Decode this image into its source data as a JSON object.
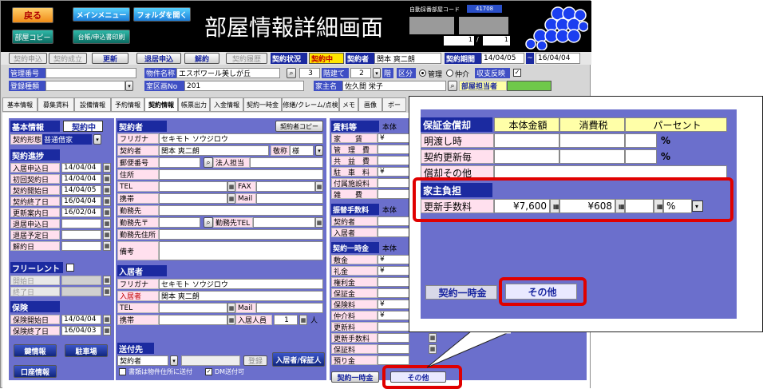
{
  "header": {
    "title": "部屋情報詳細画面",
    "back": "戻る",
    "main_menu": "メインメニュー",
    "open_folder": "フォルダを開く",
    "room_copy": "部屋コピー",
    "ledger_print": "台帳/申込書印刷",
    "auto_code_label": "自動採番部屋コード",
    "auto_code_value": "41708",
    "record_current": "1",
    "record_total": "1"
  },
  "toolbar": {
    "contract_apply": "契約申込",
    "contract_done": "契約成立",
    "update": "更新",
    "move_out_apply": "退居申込",
    "cancel": "解約",
    "contract_history": "契約履歴",
    "status_label": "契約状況",
    "status_value": "契約中",
    "contractor_label": "契約者",
    "contractor_value": "関本 爽二朗",
    "period_label": "契約期間",
    "period_from": "14/04/05",
    "period_sep": "~",
    "period_to": "16/04/04"
  },
  "row2": {
    "mgmt_no": "管理番号",
    "property_label": "物件名称",
    "property_value": "エスポワール美しが丘",
    "floor_value": "3",
    "floor_unit": "階建て",
    "floor2_value": "2",
    "floor2_unit": "階",
    "kubun": "区分",
    "opt_mgmt": "管理",
    "opt_agent": "仲介",
    "income_reflect": "収支反映",
    "reg_type": "登録種類",
    "room_no_label": "室区画No",
    "room_no_value": "201",
    "owner_label": "家主名",
    "owner_value": "佐久間 栄子",
    "staff_label": "部屋担当者"
  },
  "tabs": [
    "基本情報",
    "募集賃料",
    "設備情報",
    "予約情報",
    "契約情報",
    "帳票出力",
    "入金情報",
    "契約一時金",
    "修繕/クレーム/点検",
    "メモ",
    "画像",
    "ボー"
  ],
  "basic": {
    "head": "基本情報",
    "status": "契約中",
    "contract_type_label": "契約形態",
    "contract_type_value": "普通借家",
    "progress_head": "契約進捗",
    "rows": [
      {
        "label": "入居申込日",
        "value": "14/04/04"
      },
      {
        "label": "初回契約日",
        "value": "14/04/04"
      },
      {
        "label": "契約開始日",
        "value": "14/04/05"
      },
      {
        "label": "契約終了日",
        "value": "16/04/04"
      },
      {
        "label": "更新案内日",
        "value": "16/02/04"
      },
      {
        "label": "退居申込日",
        "value": ""
      },
      {
        "label": "退居予定日",
        "value": ""
      },
      {
        "label": "解約日",
        "value": ""
      }
    ],
    "free_rent": "フリーレント",
    "start_day": "開始日",
    "end_day": "終了日",
    "insurance_head": "保険",
    "ins_start_label": "保険開始日",
    "ins_start": "14/04/04",
    "ins_end_label": "保険終了日",
    "ins_end": "16/04/03",
    "key_info": "鍵情報",
    "parking": "駐車場",
    "account_info": "口座情報"
  },
  "contractor": {
    "head": "契約者",
    "copy_btn": "契約者コピー",
    "furigana_label": "フリガナ",
    "furigana": "セキモト ソウジロウ",
    "name_label": "契約者",
    "name": "関本 爽二朗",
    "honorific_label": "敬称",
    "honorific": "様",
    "postal": "郵便番号",
    "corp_staff": "法人担当",
    "address": "住所",
    "tel": "TEL",
    "fax": "FAX",
    "mobile": "携帯",
    "mail": "Mail",
    "work": "勤務先",
    "work_postal": "勤務先〒",
    "work_tel": "勤務先TEL",
    "work_addr": "勤務先住所",
    "remarks": "備考",
    "occupant_head": "入居者",
    "occ_furigana": "セキモト ソウジロウ",
    "occ_name_label": "入居者",
    "occ_name": "関本 爽二朗",
    "occ_count_label": "入居人員",
    "occ_count": "1",
    "occ_unit": "人",
    "send_head": "送付先",
    "send_value": "契約者",
    "register": "登録",
    "occ_guarantor": "入居者/保証人",
    "send_note1": "書類は物件住所に送付",
    "send_note2": "DM送付可"
  },
  "fees": {
    "head": "賃料等",
    "col": "本体",
    "rows": [
      "家　　賃",
      "管　理　費",
      "共　益　費",
      "駐　車　料",
      "付属施設料",
      "雑　　費"
    ],
    "vals": [
      "¥",
      "",
      "",
      "¥",
      "",
      ""
    ],
    "transfer_head": "振替手数料",
    "transfer_col": "本体",
    "transfer_rows": [
      "契約者",
      "入居者"
    ],
    "lump_head": "契約一時金",
    "lump_col": "本体",
    "lump_rows": [
      "敷金",
      "礼金",
      "権利金",
      "保証金",
      "保険料",
      "仲介料",
      "更新料",
      "更新手数料",
      "保証料",
      "預り金"
    ],
    "lump_vals": [
      "¥",
      "¥",
      "",
      "",
      "¥",
      "¥",
      "",
      "",
      "",
      ""
    ],
    "tab1": "契約一時金",
    "tab2": "その他"
  },
  "zoom": {
    "head": "保証金償却",
    "col1": "本体金額",
    "col2": "消費税",
    "col3": "パーセント",
    "rows": [
      {
        "label": "明渡し時",
        "pct": "%"
      },
      {
        "label": "契約更新毎",
        "pct": "%"
      },
      {
        "label": "償却その他",
        "pct": ""
      }
    ],
    "landlord_head": "家主負担",
    "renew_label": "更新手数料",
    "renew_amount": "¥7,600",
    "renew_tax": "¥608",
    "renew_pct_unit": "%",
    "tab1": "契約一時金",
    "tab2": "その他"
  }
}
